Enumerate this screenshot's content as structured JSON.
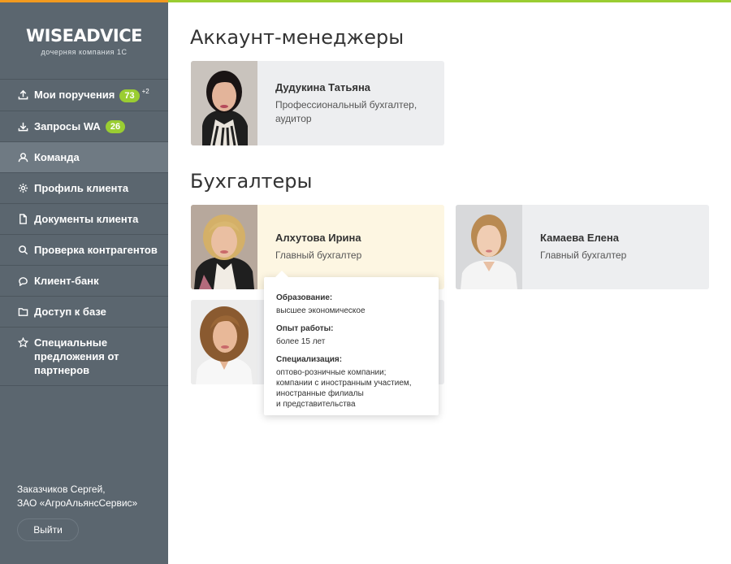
{
  "brand": {
    "logo": "WISEADVICE",
    "subtitle": "дочерняя компания 1С",
    "accent_color": "#9acd32",
    "sidebar_color": "#5b666f",
    "top_orange": "#f29a1f"
  },
  "nav": [
    {
      "label": "Мои поручения",
      "badge": "73",
      "sup": "+2",
      "icon": "upload-icon"
    },
    {
      "label": "Запросы WA",
      "badge": "26",
      "icon": "download-icon"
    },
    {
      "label": "Команда",
      "icon": "user-icon",
      "active": true
    },
    {
      "label": "Профиль клиента",
      "icon": "gear-icon"
    },
    {
      "label": "Документы клиента",
      "icon": "document-icon"
    },
    {
      "label": "Проверка контрагентов",
      "icon": "search-icon"
    },
    {
      "label": "Клиент-банк",
      "icon": "bank-icon"
    },
    {
      "label": "Доступ к базе",
      "icon": "folder-icon"
    },
    {
      "label": "Специальные предложения от партнеров",
      "icon": "star-icon"
    }
  ],
  "user": {
    "name": "Заказчиков Сергей,",
    "company": "ЗАО «АгроАльянсСервис»",
    "logout": "Выйти"
  },
  "sections": {
    "managers_title": "Аккаунт-менеджеры",
    "accountants_title": "Бухгалтеры"
  },
  "managers": [
    {
      "name": "Дудукина Татьяна",
      "role": "Профессиональный бухгалтер, аудитор"
    }
  ],
  "accountants": [
    {
      "name": "Алхутова Ирина",
      "role": "Главный бухгалтер"
    },
    {
      "name": "Камаева Елена",
      "role": "Главный бухгалтер"
    },
    {
      "name": "",
      "role": ""
    }
  ],
  "tooltip": {
    "education_label": "Образование:",
    "education": "высшее экономическое",
    "experience_label": "Опыт работы:",
    "experience": "более 15 лет",
    "spec_label": "Специализация:",
    "spec_lines": [
      "оптово-розничные компании;",
      "компании с иностранным участием,",
      "иностранные филиалы",
      "и представительства"
    ]
  }
}
